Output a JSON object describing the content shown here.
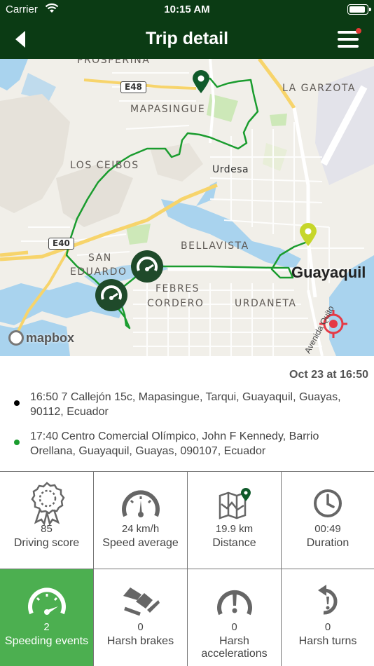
{
  "status": {
    "carrier": "Carrier",
    "time": "10:15 AM"
  },
  "nav": {
    "title": "Trip detail",
    "back_icon": "back-arrow-icon",
    "menu_icon": "hamburger-menu-icon",
    "menu_badge": true
  },
  "map": {
    "labels": {
      "prosperina": "PROSPERINA",
      "mapasingue": "MAPASINGUE",
      "la_garzota": "LA GARZOTA",
      "los_ceibos": "LOS CEIBOS",
      "urdesa": "Urdesa",
      "bellavista": "BELLAVISTA",
      "guayaquil": "Guayaquil",
      "san": "SAN",
      "eduardo": "EDUARDO",
      "febres": "FEBRES",
      "cordero": "CORDERO",
      "urdaneta": "URDANETA",
      "avenida_quito": "Avenida Quito",
      "e48": "E48",
      "e40": "E40",
      "mapbox": "mapbox"
    },
    "colors": {
      "route": "#1a9c2e",
      "start_pin": "#0f5a2a",
      "end_pin": "#c6d62a",
      "event_marker": "#1f4a2a",
      "target": "#e53945",
      "water": "#a9d3ee",
      "park": "#cde8b8"
    }
  },
  "trip": {
    "date": "Oct 23 at 16:50",
    "start": {
      "text": "16:50 7 Callejón 15c, Mapasingue, Tarqui, Guayaquil, Guayas, 90112, Ecuador",
      "dot_color": "#000000"
    },
    "end": {
      "text": "17:40 Centro Comercial Olímpico, John F Kennedy, Barrio Orellana, Guayaquil, Guayas, 090107, Ecuador",
      "dot_color": "#1a9c2e"
    }
  },
  "stats": {
    "driving_score": {
      "value": "85",
      "label": "Driving score",
      "icon": "award-ribbon-icon"
    },
    "speed_average": {
      "value": "24 km/h",
      "label": "Speed average",
      "icon": "speedometer-icon"
    },
    "distance": {
      "value": "19.9 km",
      "label": "Distance",
      "icon": "map-pin-icon"
    },
    "duration": {
      "value": "00:49",
      "label": "Duration",
      "icon": "clock-icon"
    },
    "speeding_events": {
      "value": "2",
      "label": "Speeding events",
      "icon": "speedometer-fast-icon"
    },
    "harsh_brakes": {
      "value": "0",
      "label": "Harsh brakes",
      "icon": "brake-pedal-icon"
    },
    "harsh_accelerations": {
      "value": "0",
      "label": "Harsh accelerations",
      "icon": "acceleration-warning-icon"
    },
    "harsh_turns": {
      "value": "0",
      "label": "Harsh turns",
      "icon": "turn-icon"
    }
  }
}
